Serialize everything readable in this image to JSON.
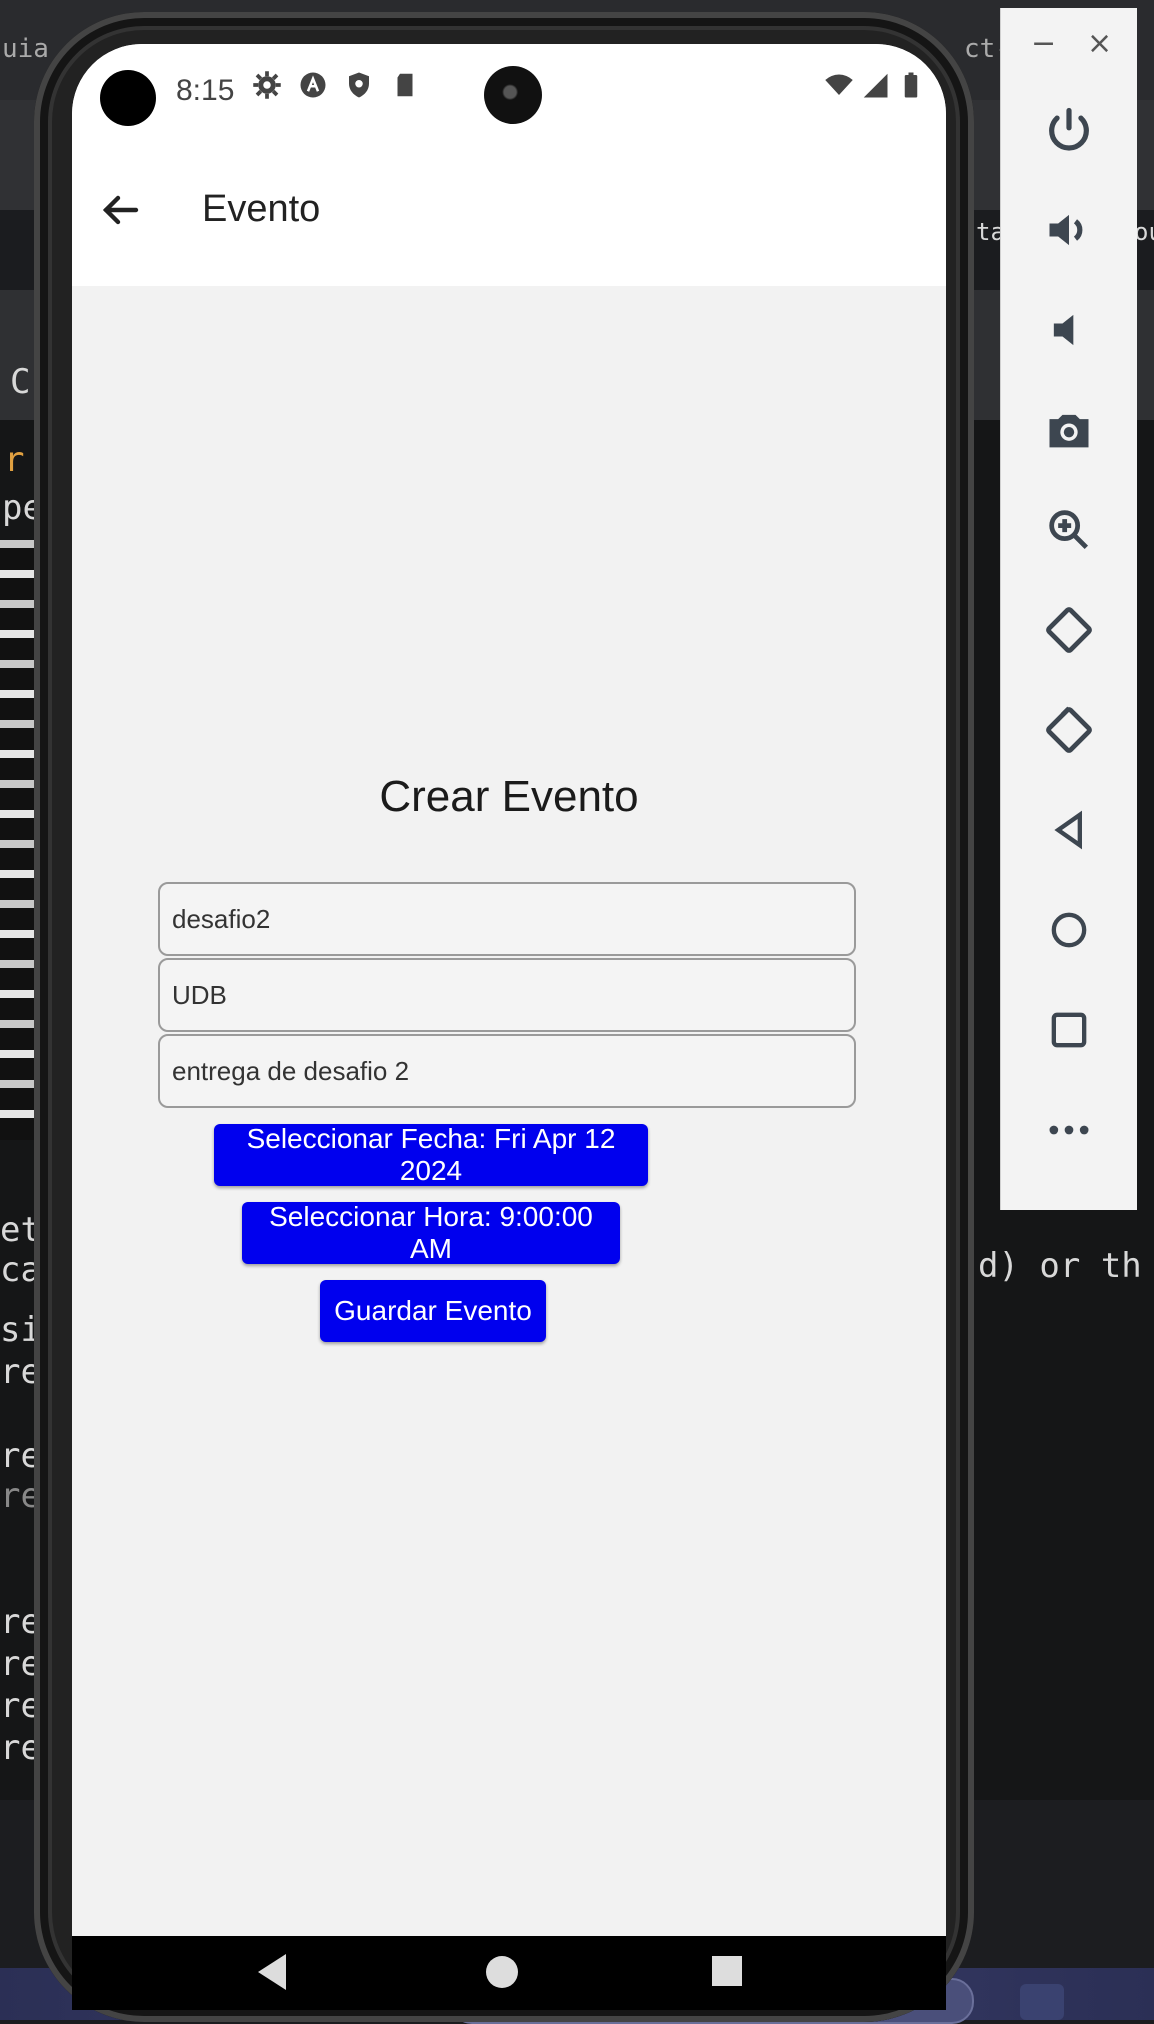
{
  "background": {
    "fragments": [
      "uia",
      "ct-",
      "C",
      "r",
      "pe",
      "ta",
      "ou",
      "et",
      "ca",
      "si",
      "re",
      "re",
      "re",
      "re",
      "re",
      "re",
      "re",
      "d) or th"
    ]
  },
  "status_bar": {
    "time": "8:15",
    "icons": [
      "settings-icon",
      "a-badge-icon",
      "shield-icon",
      "sd-card-icon"
    ],
    "right_icons": [
      "wifi-icon",
      "signal-icon",
      "battery-icon"
    ]
  },
  "app_bar": {
    "title": "Evento"
  },
  "form": {
    "title": "Crear Evento",
    "fields": [
      {
        "name": "event-name-field",
        "value": "desafio2"
      },
      {
        "name": "event-location-field",
        "value": "UDB"
      },
      {
        "name": "event-description-field",
        "value": "entrega de desafio 2"
      }
    ],
    "select_date_label": "Seleccionar Fecha: Fri Apr 12 2024",
    "select_time_label": "Seleccionar Hora: 9:00:00 AM",
    "save_label": "Guardar Evento"
  },
  "emulator_toolbar": {
    "minimize": "−",
    "close": "×",
    "items": [
      "power-icon",
      "volume-up-icon",
      "volume-down-icon",
      "camera-icon",
      "zoom-icon",
      "rotate-left-icon",
      "rotate-right-icon",
      "back-icon",
      "home-icon",
      "overview-icon",
      "more-icon"
    ]
  },
  "colors": {
    "button": "#0000ee",
    "cursor": "#2aa198"
  }
}
